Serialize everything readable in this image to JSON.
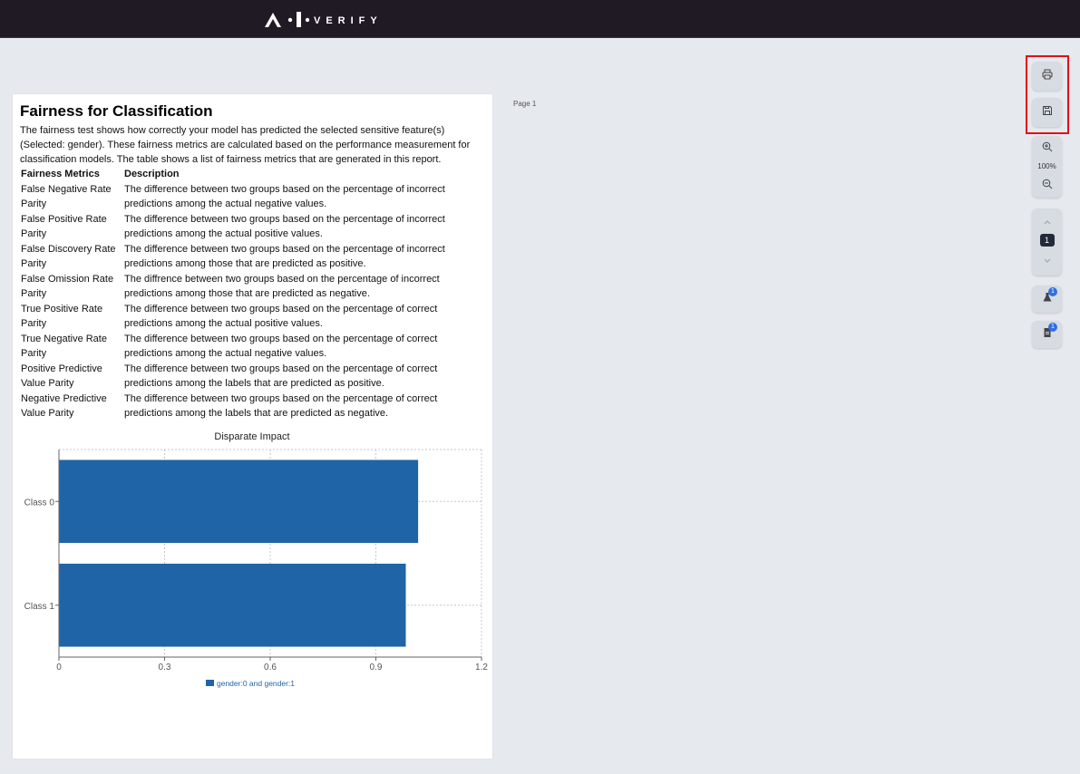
{
  "app": {
    "logo_text": "A·I·VERIFY"
  },
  "report": {
    "page_label": "Page 1",
    "title": "Fairness for Classification",
    "intro": "The fairness test shows how correctly your model has predicted the selected sensitive feature(s) (Selected: gender). These fairness metrics are calculated based on the performance measurement for classification models. The table shows a list of fairness metrics that are generated in this report.",
    "table": {
      "headers": [
        "Fairness Metrics",
        "Description"
      ],
      "rows": [
        [
          "False Negative Rate Parity",
          "The difference between two groups based on the percentage of incorrect predictions among the actual negative values."
        ],
        [
          "False Positive Rate Parity",
          "The difference between two groups based on the percentage of incorrect predictions among the actual positive values."
        ],
        [
          "False Discovery Rate Parity",
          "The difference between two groups based on the percentage of incorrect predictions among those that are predicted as positive."
        ],
        [
          "False Omission Rate Parity",
          "The diffrence between two groups based on the percentage of incorrect predictions among those that are predicted as negative."
        ],
        [
          "True Positive Rate Parity",
          "The difference between two groups based on the percentage of correct predictions among the actual positive values."
        ],
        [
          "True Negative Rate Parity",
          "The difference between two groups based on the percentage of correct predictions among the actual negative values."
        ],
        [
          "Positive Predictive Value Parity",
          "The difference between two groups based on the percentage of correct predictions among the labels that are predicted as positive."
        ],
        [
          "Negative Predictive Value Parity",
          "The difference between two groups based on the percentage of correct predictions among the labels that are predicted as negative."
        ]
      ]
    }
  },
  "chart_data": {
    "type": "bar",
    "orientation": "horizontal",
    "title": "Disparate Impact",
    "categories": [
      "Class 0",
      "Class 1"
    ],
    "series": [
      {
        "name": "gender:0 and gender:1",
        "values": [
          1.02,
          0.985
        ],
        "color": "#1f64a6"
      }
    ],
    "xlim": [
      0,
      1.2
    ],
    "xticks": [
      "0",
      "0.3",
      "0.6",
      "0.9",
      "1.2"
    ],
    "grid": true,
    "legend": "bottom"
  },
  "toolbar": {
    "print_icon": "printer-icon",
    "save_icon": "save-icon",
    "zoom_in_icon": "zoom-in-icon",
    "zoom_level": "100%",
    "zoom_out_icon": "zoom-out-icon",
    "page_up_icon": "chevron-up-icon",
    "current_page": "1",
    "page_down_icon": "chevron-down-icon",
    "flask_badge": "1",
    "report_badge": "1"
  },
  "colors": {
    "topbar": "#1f1a24",
    "background": "#e6e9ee",
    "bar": "#1f64a6",
    "badge": "#2f6fe4",
    "highlight": "#e0101a"
  }
}
